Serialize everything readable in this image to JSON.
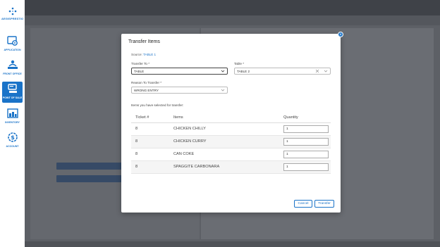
{
  "sidebar": {
    "brand": "AEGISPRESTIO",
    "items": [
      {
        "label": "APPLICATION",
        "icon": "application-gear-icon"
      },
      {
        "label": "FRONT OFFICE",
        "icon": "front-office-icon"
      },
      {
        "label": "POINT OF SALE",
        "icon": "point-of-sale-icon",
        "active": true
      },
      {
        "label": "INVENTORY",
        "icon": "inventory-icon"
      },
      {
        "label": "ACCOUNT",
        "icon": "account-dollar-icon"
      }
    ]
  },
  "modal": {
    "title": "Transfer Items",
    "source_label": "Source:",
    "source_value": "TABLE 1",
    "transfer_to": {
      "label": "Transfer To *",
      "value": "TABLE"
    },
    "table": {
      "label": "Table *",
      "value": "TABLE 2"
    },
    "reason": {
      "label": "Reason To Transfer *",
      "value": "WRONG ENTRY"
    },
    "items_note": "Items you have selected for transfer:",
    "columns": [
      "Ticket #",
      "Items",
      "Quantity"
    ],
    "rows": [
      {
        "ticket": "8",
        "item": "CHICKEN CHILLY",
        "qty": "1"
      },
      {
        "ticket": "8",
        "item": "CHICKEN CURRY",
        "qty": "1"
      },
      {
        "ticket": "8",
        "item": "CAN COKE",
        "qty": "1"
      },
      {
        "ticket": "8",
        "item": "SPAGGITE CARBONARA",
        "qty": "1"
      }
    ],
    "cancel_label": "Cancel",
    "transfer_label": "Transfer",
    "close_glyph": "×"
  },
  "colors": {
    "accent": "#1a73c8",
    "overlay": "#5d6066"
  }
}
